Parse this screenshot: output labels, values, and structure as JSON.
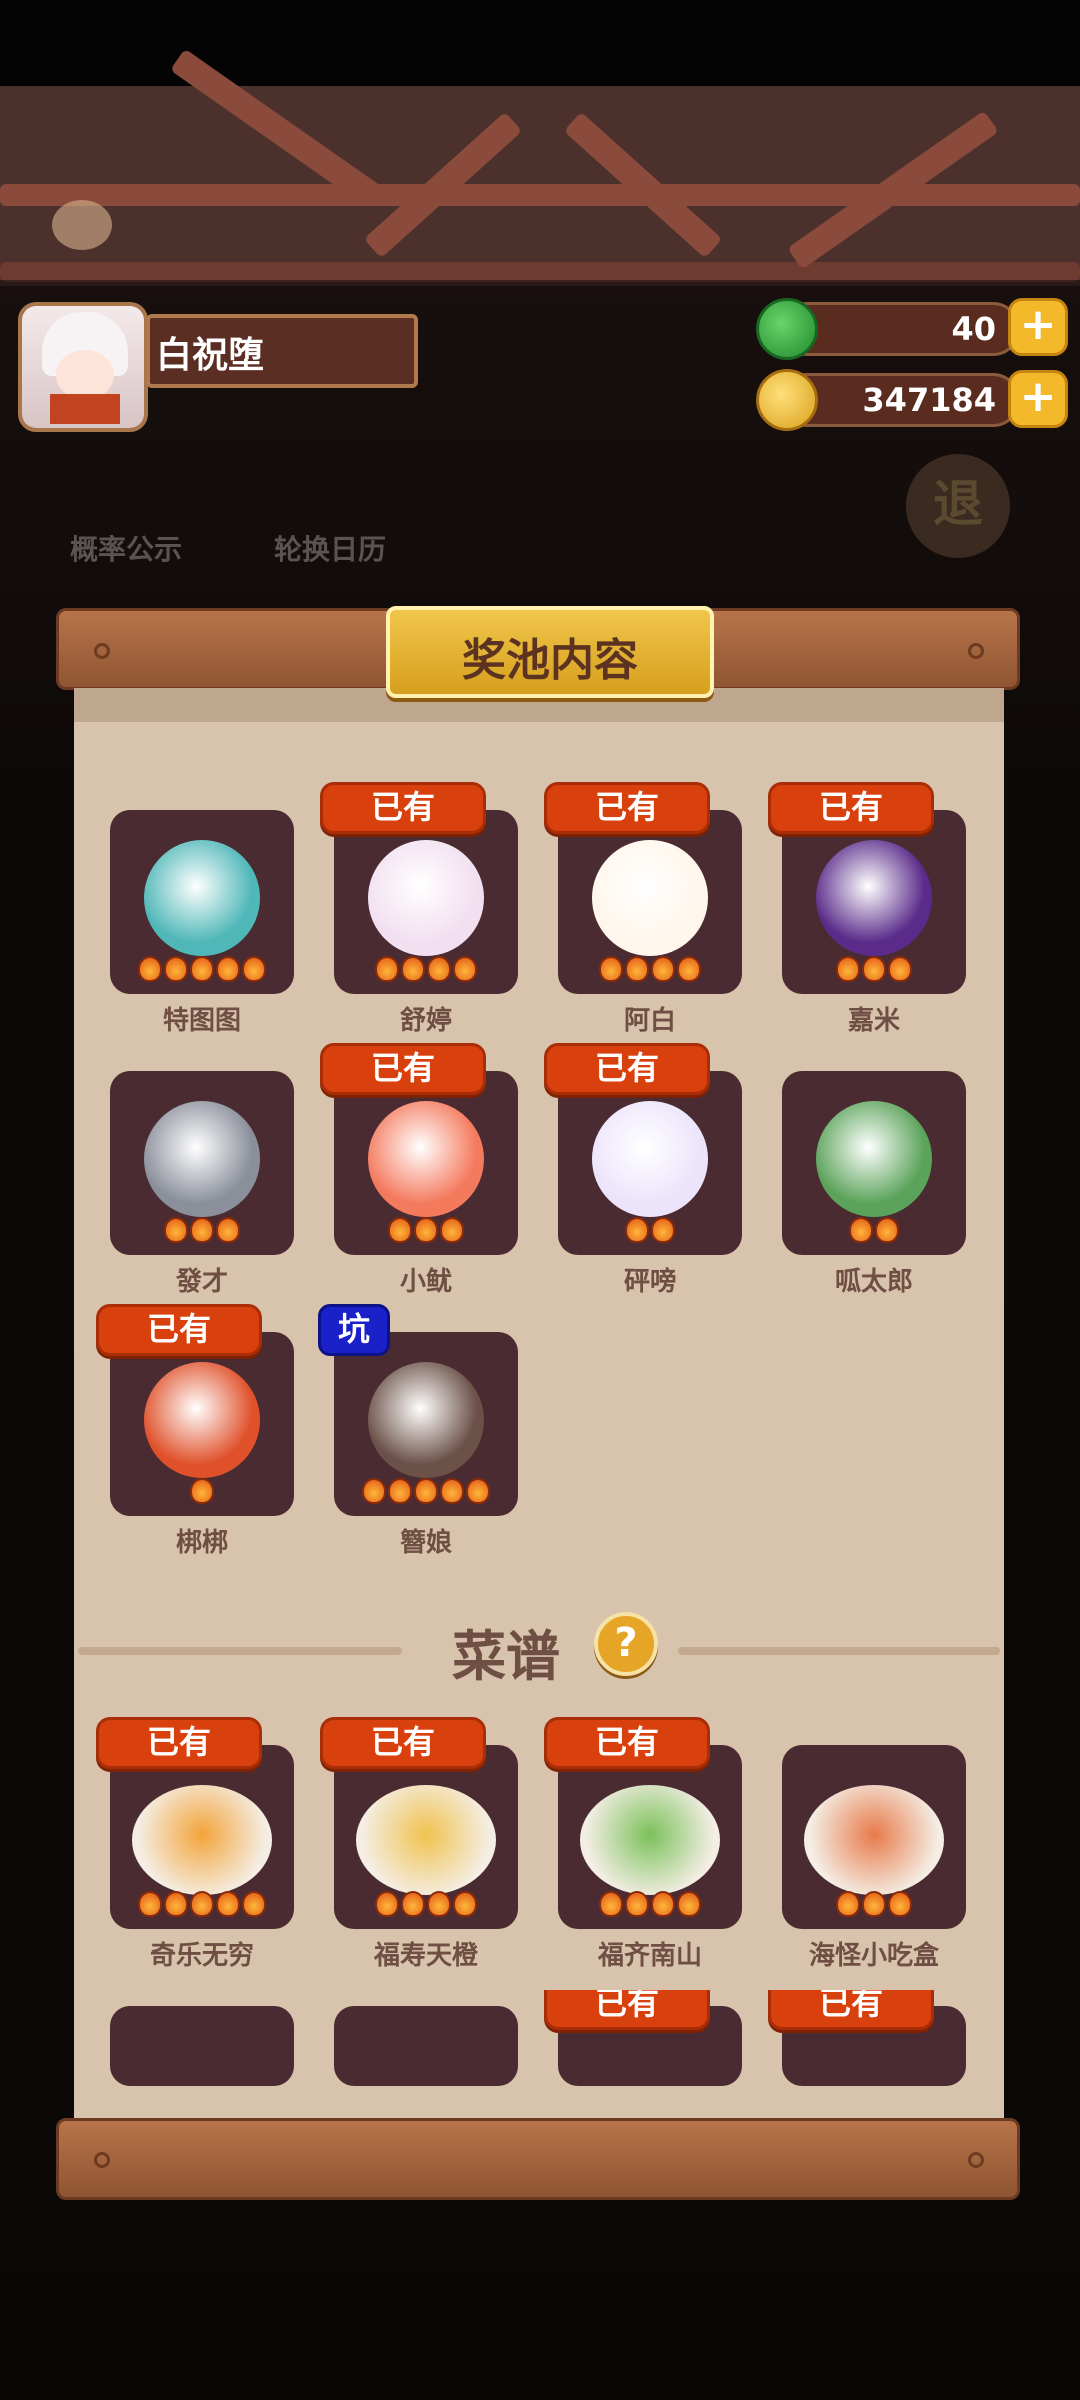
{
  "user": {
    "name": "白祝堕"
  },
  "currency": {
    "jade": {
      "value": "40",
      "plus": "+"
    },
    "coins": {
      "value": "347184",
      "plus": "+"
    }
  },
  "background": {
    "probability": "概率公示",
    "calendar": "轮换日历",
    "exit": "退"
  },
  "panel": {
    "title": "奖池内容"
  },
  "badges": {
    "owned": "已有",
    "pit": "坑"
  },
  "characters": [
    {
      "name": "特图图",
      "owned": false,
      "stars": 5
    },
    {
      "name": "舒婷",
      "owned": true,
      "stars": 4
    },
    {
      "name": "阿白",
      "owned": true,
      "stars": 4
    },
    {
      "name": "嘉米",
      "owned": true,
      "stars": 3
    },
    {
      "name": "發才",
      "owned": false,
      "stars": 3
    },
    {
      "name": "小鱿",
      "owned": true,
      "stars": 3
    },
    {
      "name": "砰嗙",
      "owned": true,
      "stars": 2
    },
    {
      "name": "呱太郎",
      "owned": false,
      "stars": 2
    },
    {
      "name": "梆梆",
      "owned": true,
      "stars": 1
    },
    {
      "name": "簪娘",
      "owned": false,
      "pit": true,
      "stars": 5
    }
  ],
  "recipes_section": {
    "title": "菜谱",
    "help": "?"
  },
  "recipes": [
    {
      "name": "奇乐无穷",
      "owned": true,
      "stars": 5
    },
    {
      "name": "福寿天橙",
      "owned": true,
      "stars": 4
    },
    {
      "name": "福齐南山",
      "owned": true,
      "stars": 4
    },
    {
      "name": "海怪小吃盒",
      "owned": false,
      "stars": 3
    }
  ],
  "recipes_row2_owned": [
    false,
    false,
    true,
    true
  ],
  "colors": {
    "badge_owned": "#d8410e",
    "badge_pit": "#1a21c9",
    "paper": "#d8c3ac",
    "card": "#4a2b31"
  }
}
